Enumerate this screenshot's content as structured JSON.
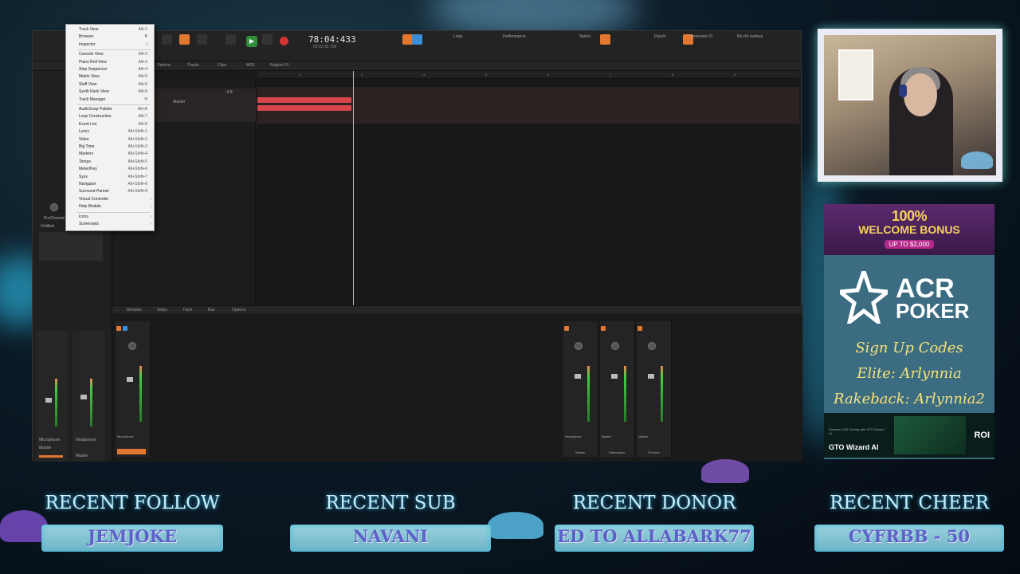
{
  "daw": {
    "time": "78:04:433",
    "time_sub": "00:02:35:728",
    "toolbar_panels": [
      "Loop",
      "Performance",
      "Select",
      "Punch",
      "Screenset 01",
      "No ctrl surface"
    ],
    "subbar": [
      "Options",
      "Tracks",
      "Clips",
      "MIDI",
      "Region FX"
    ],
    "inspector_label": "ProChannel",
    "track": {
      "name": "Untitled",
      "output": "Master",
      "value": "-4.8"
    },
    "ruler": [
      "2",
      "3",
      "4",
      "5",
      "6",
      "7",
      "8",
      "9"
    ],
    "console_bar": [
      "Modules",
      "Strips",
      "Track",
      "Bus",
      "Options"
    ],
    "console_channels": [
      {
        "label": "Audio",
        "io": "Microphone",
        "out": "Master"
      },
      {
        "label": "Master",
        "io": "Headphone",
        "out": "Master"
      },
      {
        "label": "Master",
        "io": "Headphone",
        "out": "Master"
      },
      {
        "label": "Metronome",
        "io": "Master",
        "out": "Master"
      },
      {
        "label": "Preview",
        "io": "Master",
        "out": "Master"
      }
    ]
  },
  "menu": {
    "items": [
      {
        "label": "Track View",
        "shortcut": "Alt+1"
      },
      {
        "label": "Browser",
        "shortcut": "B"
      },
      {
        "label": "Inspector",
        "shortcut": "I"
      },
      {
        "sep": true
      },
      {
        "label": "Console View",
        "shortcut": "Alt+2"
      },
      {
        "label": "Piano Roll View",
        "shortcut": "Alt+3"
      },
      {
        "label": "Step Sequencer",
        "shortcut": "Alt+4"
      },
      {
        "label": "Matrix View",
        "shortcut": "Alt+5"
      },
      {
        "label": "Staff View",
        "shortcut": "Alt+6"
      },
      {
        "label": "Synth Rack View",
        "shortcut": "Alt+8"
      },
      {
        "label": "Track Manager",
        "shortcut": "H"
      },
      {
        "sep": true
      },
      {
        "label": "AudioSnap Palette",
        "shortcut": "Alt+A"
      },
      {
        "label": "Loop Construction",
        "shortcut": "Alt+7"
      },
      {
        "label": "Event List",
        "shortcut": "Alt+8"
      },
      {
        "label": "Lyrics",
        "shortcut": "Alt+Shift+1"
      },
      {
        "label": "Video",
        "shortcut": "Alt+Shift+2"
      },
      {
        "label": "Big Time",
        "shortcut": "Alt+Shift+3"
      },
      {
        "label": "Markers",
        "shortcut": "Alt+Shift+4"
      },
      {
        "label": "Tempo",
        "shortcut": "Alt+Shift+5"
      },
      {
        "label": "Meter/Key",
        "shortcut": "Alt+Shift+6"
      },
      {
        "label": "Sysx",
        "shortcut": "Alt+Shift+7"
      },
      {
        "label": "Navigator",
        "shortcut": "Alt+Shift+8"
      },
      {
        "label": "Surround Panner",
        "shortcut": "Alt+Shift+9"
      },
      {
        "label": "Virtual Controller",
        "shortcut": "",
        "submenu": true
      },
      {
        "label": "Help Module",
        "shortcut": "",
        "submenu": true
      },
      {
        "sep": true
      },
      {
        "label": "Icons",
        "shortcut": "",
        "submenu": true
      },
      {
        "label": "Screensets",
        "shortcut": "",
        "submenu": true
      }
    ]
  },
  "sponsor": {
    "bonus_line1": "100%",
    "bonus_line2": "WELCOME BONUS",
    "bonus_line3": "UP TO $2,000",
    "brand_top": "ACR",
    "brand_bottom": "POKER",
    "signup": "Sign Up Codes",
    "elite": "Elite: Arlynnia",
    "rakeback": "Rakeback: Arlynnia2",
    "gto_name": "GTO Wizard AI",
    "gto_tagline": "Discover ICM Solving with GTO Wizard AI",
    "gto_roi": "ROI"
  },
  "banners": [
    {
      "title": "RECENT FOLLOW",
      "value": "JEMJOKE"
    },
    {
      "title": "RECENT SUB",
      "value": "NAVANI"
    },
    {
      "title": "RECENT DONOR",
      "value": "ED TO ALLABARK77"
    },
    {
      "title": "RECENT CHEER",
      "value": "CYFRBB - 50"
    }
  ]
}
